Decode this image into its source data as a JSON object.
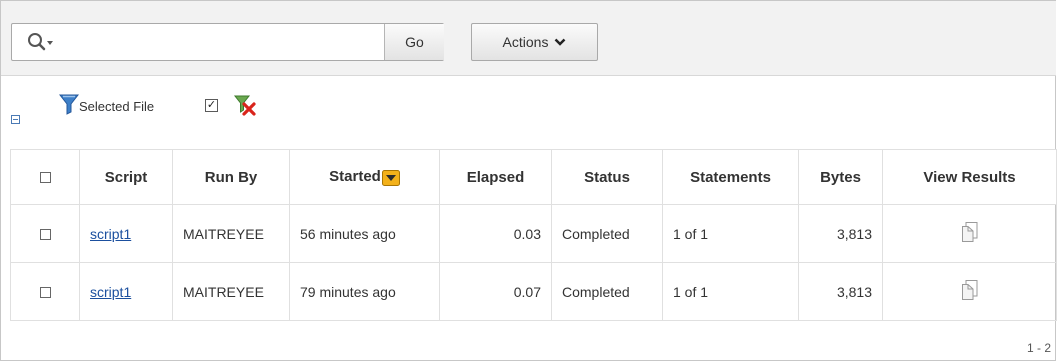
{
  "toolbar": {
    "search_placeholder": "",
    "go_label": "Go",
    "actions_label": "Actions"
  },
  "filter": {
    "label": "Selected File",
    "checked_mark": "✓"
  },
  "table": {
    "headers": {
      "script": "Script",
      "run_by": "Run By",
      "started": "Started",
      "elapsed": "Elapsed",
      "status": "Status",
      "statements": "Statements",
      "bytes": "Bytes",
      "view_results": "View Results"
    },
    "rows": [
      {
        "script": "script1",
        "run_by": "MAITREYEE",
        "started": "56 minutes ago",
        "elapsed": "0.03",
        "status": "Completed",
        "statements": "1 of 1",
        "bytes": "3,813"
      },
      {
        "script": "script1",
        "run_by": "MAITREYEE",
        "started": "79 minutes ago",
        "elapsed": "0.07",
        "status": "Completed",
        "statements": "1 of 1",
        "bytes": "3,813"
      }
    ]
  },
  "pagination": {
    "label": "1 - 2"
  },
  "icons": {
    "search": "search-icon",
    "filter": "funnel-icon",
    "remove_filter": "remove-filter-icon",
    "sort": "sort-descending-icon",
    "view_results": "document-icon"
  },
  "colors": {
    "link": "#1b4f9e",
    "funnel": "#3d7fc8",
    "remove_x": "#d9241b",
    "sort_badge": "#f3b11a"
  }
}
